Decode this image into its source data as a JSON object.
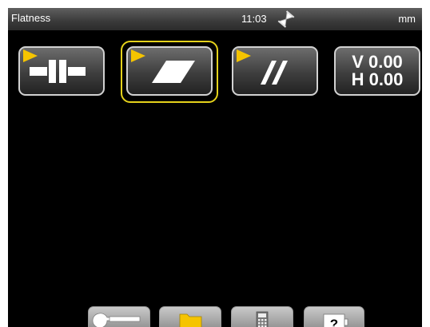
{
  "header": {
    "title": "Flatness",
    "time": "11:03",
    "units": "mm",
    "busy_icon": "hourglass-icon"
  },
  "tiles": [
    {
      "name": "machine-alignment",
      "icon": "coupling-icon",
      "selected": false
    },
    {
      "name": "flatness",
      "icon": "plane-icon",
      "selected": true
    },
    {
      "name": "parallelism",
      "icon": "parallel-lines-icon",
      "selected": false
    },
    {
      "name": "values",
      "v_label": "V 0.00",
      "h_label": "H 0.00",
      "selected": false
    }
  ],
  "dock": [
    {
      "name": "settings",
      "icon": "wrench-icon"
    },
    {
      "name": "files",
      "icon": "folder-icon"
    },
    {
      "name": "calculator",
      "icon": "calculator-icon",
      "active": true
    },
    {
      "name": "help",
      "icon": "help-icon",
      "label": "?"
    }
  ],
  "colors": {
    "accent_yellow": "#f5c400",
    "selection_border": "#e5d21b",
    "background": "#000000",
    "tile_border": "#d2d2d2"
  }
}
